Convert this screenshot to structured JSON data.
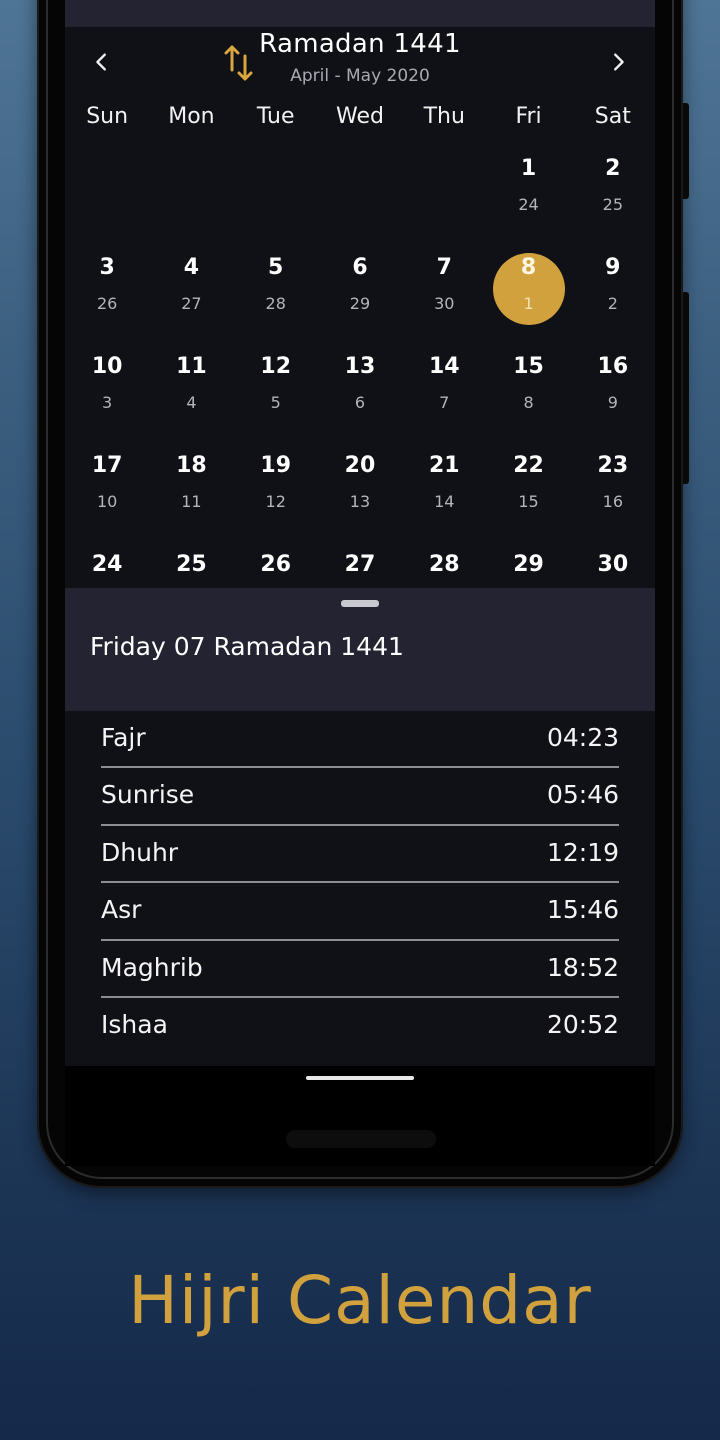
{
  "header": {
    "title": "Ramadan 1441",
    "subtitle": "April - May 2020",
    "prev_icon": "chevron-left-icon",
    "next_icon": "chevron-right-icon",
    "swap_icon": "swap-vertical-arrows-icon"
  },
  "weekdays": [
    "Sun",
    "Mon",
    "Tue",
    "Wed",
    "Thu",
    "Fri",
    "Sat"
  ],
  "calendar": {
    "selected": {
      "gregorian": "8",
      "hijri": "1"
    },
    "weeks": [
      [
        null,
        null,
        null,
        null,
        null,
        {
          "g": "1",
          "h": "24"
        },
        {
          "g": "2",
          "h": "25"
        }
      ],
      [
        {
          "g": "3",
          "h": "26"
        },
        {
          "g": "4",
          "h": "27"
        },
        {
          "g": "5",
          "h": "28"
        },
        {
          "g": "6",
          "h": "29"
        },
        {
          "g": "7",
          "h": "30"
        },
        {
          "g": "8",
          "h": "1",
          "selected": true
        },
        {
          "g": "9",
          "h": "2"
        }
      ],
      [
        {
          "g": "10",
          "h": "3"
        },
        {
          "g": "11",
          "h": "4"
        },
        {
          "g": "12",
          "h": "5"
        },
        {
          "g": "13",
          "h": "6"
        },
        {
          "g": "14",
          "h": "7"
        },
        {
          "g": "15",
          "h": "8"
        },
        {
          "g": "16",
          "h": "9"
        }
      ],
      [
        {
          "g": "17",
          "h": "10"
        },
        {
          "g": "18",
          "h": "11"
        },
        {
          "g": "19",
          "h": "12"
        },
        {
          "g": "20",
          "h": "13"
        },
        {
          "g": "21",
          "h": "14"
        },
        {
          "g": "22",
          "h": "15"
        },
        {
          "g": "23",
          "h": "16"
        }
      ],
      [
        {
          "g": "24",
          "h": ""
        },
        {
          "g": "25",
          "h": ""
        },
        {
          "g": "26",
          "h": ""
        },
        {
          "g": "27",
          "h": ""
        },
        {
          "g": "28",
          "h": ""
        },
        {
          "g": "29",
          "h": ""
        },
        {
          "g": "30",
          "h": ""
        }
      ]
    ]
  },
  "sheet": {
    "date_label": "Friday 07 Ramadan 1441"
  },
  "prayers": [
    {
      "name": "Fajr",
      "time": "04:23"
    },
    {
      "name": "Sunrise",
      "time": "05:46"
    },
    {
      "name": "Dhuhr",
      "time": "12:19"
    },
    {
      "name": "Asr",
      "time": "15:46"
    },
    {
      "name": "Maghrib",
      "time": "18:52"
    },
    {
      "name": "Ishaa",
      "time": "20:52"
    }
  ],
  "caption": "Hijri Calendar",
  "colors": {
    "accent": "#d1a13d",
    "screen_bg": "#101017",
    "sheet_bg": "#232331"
  }
}
